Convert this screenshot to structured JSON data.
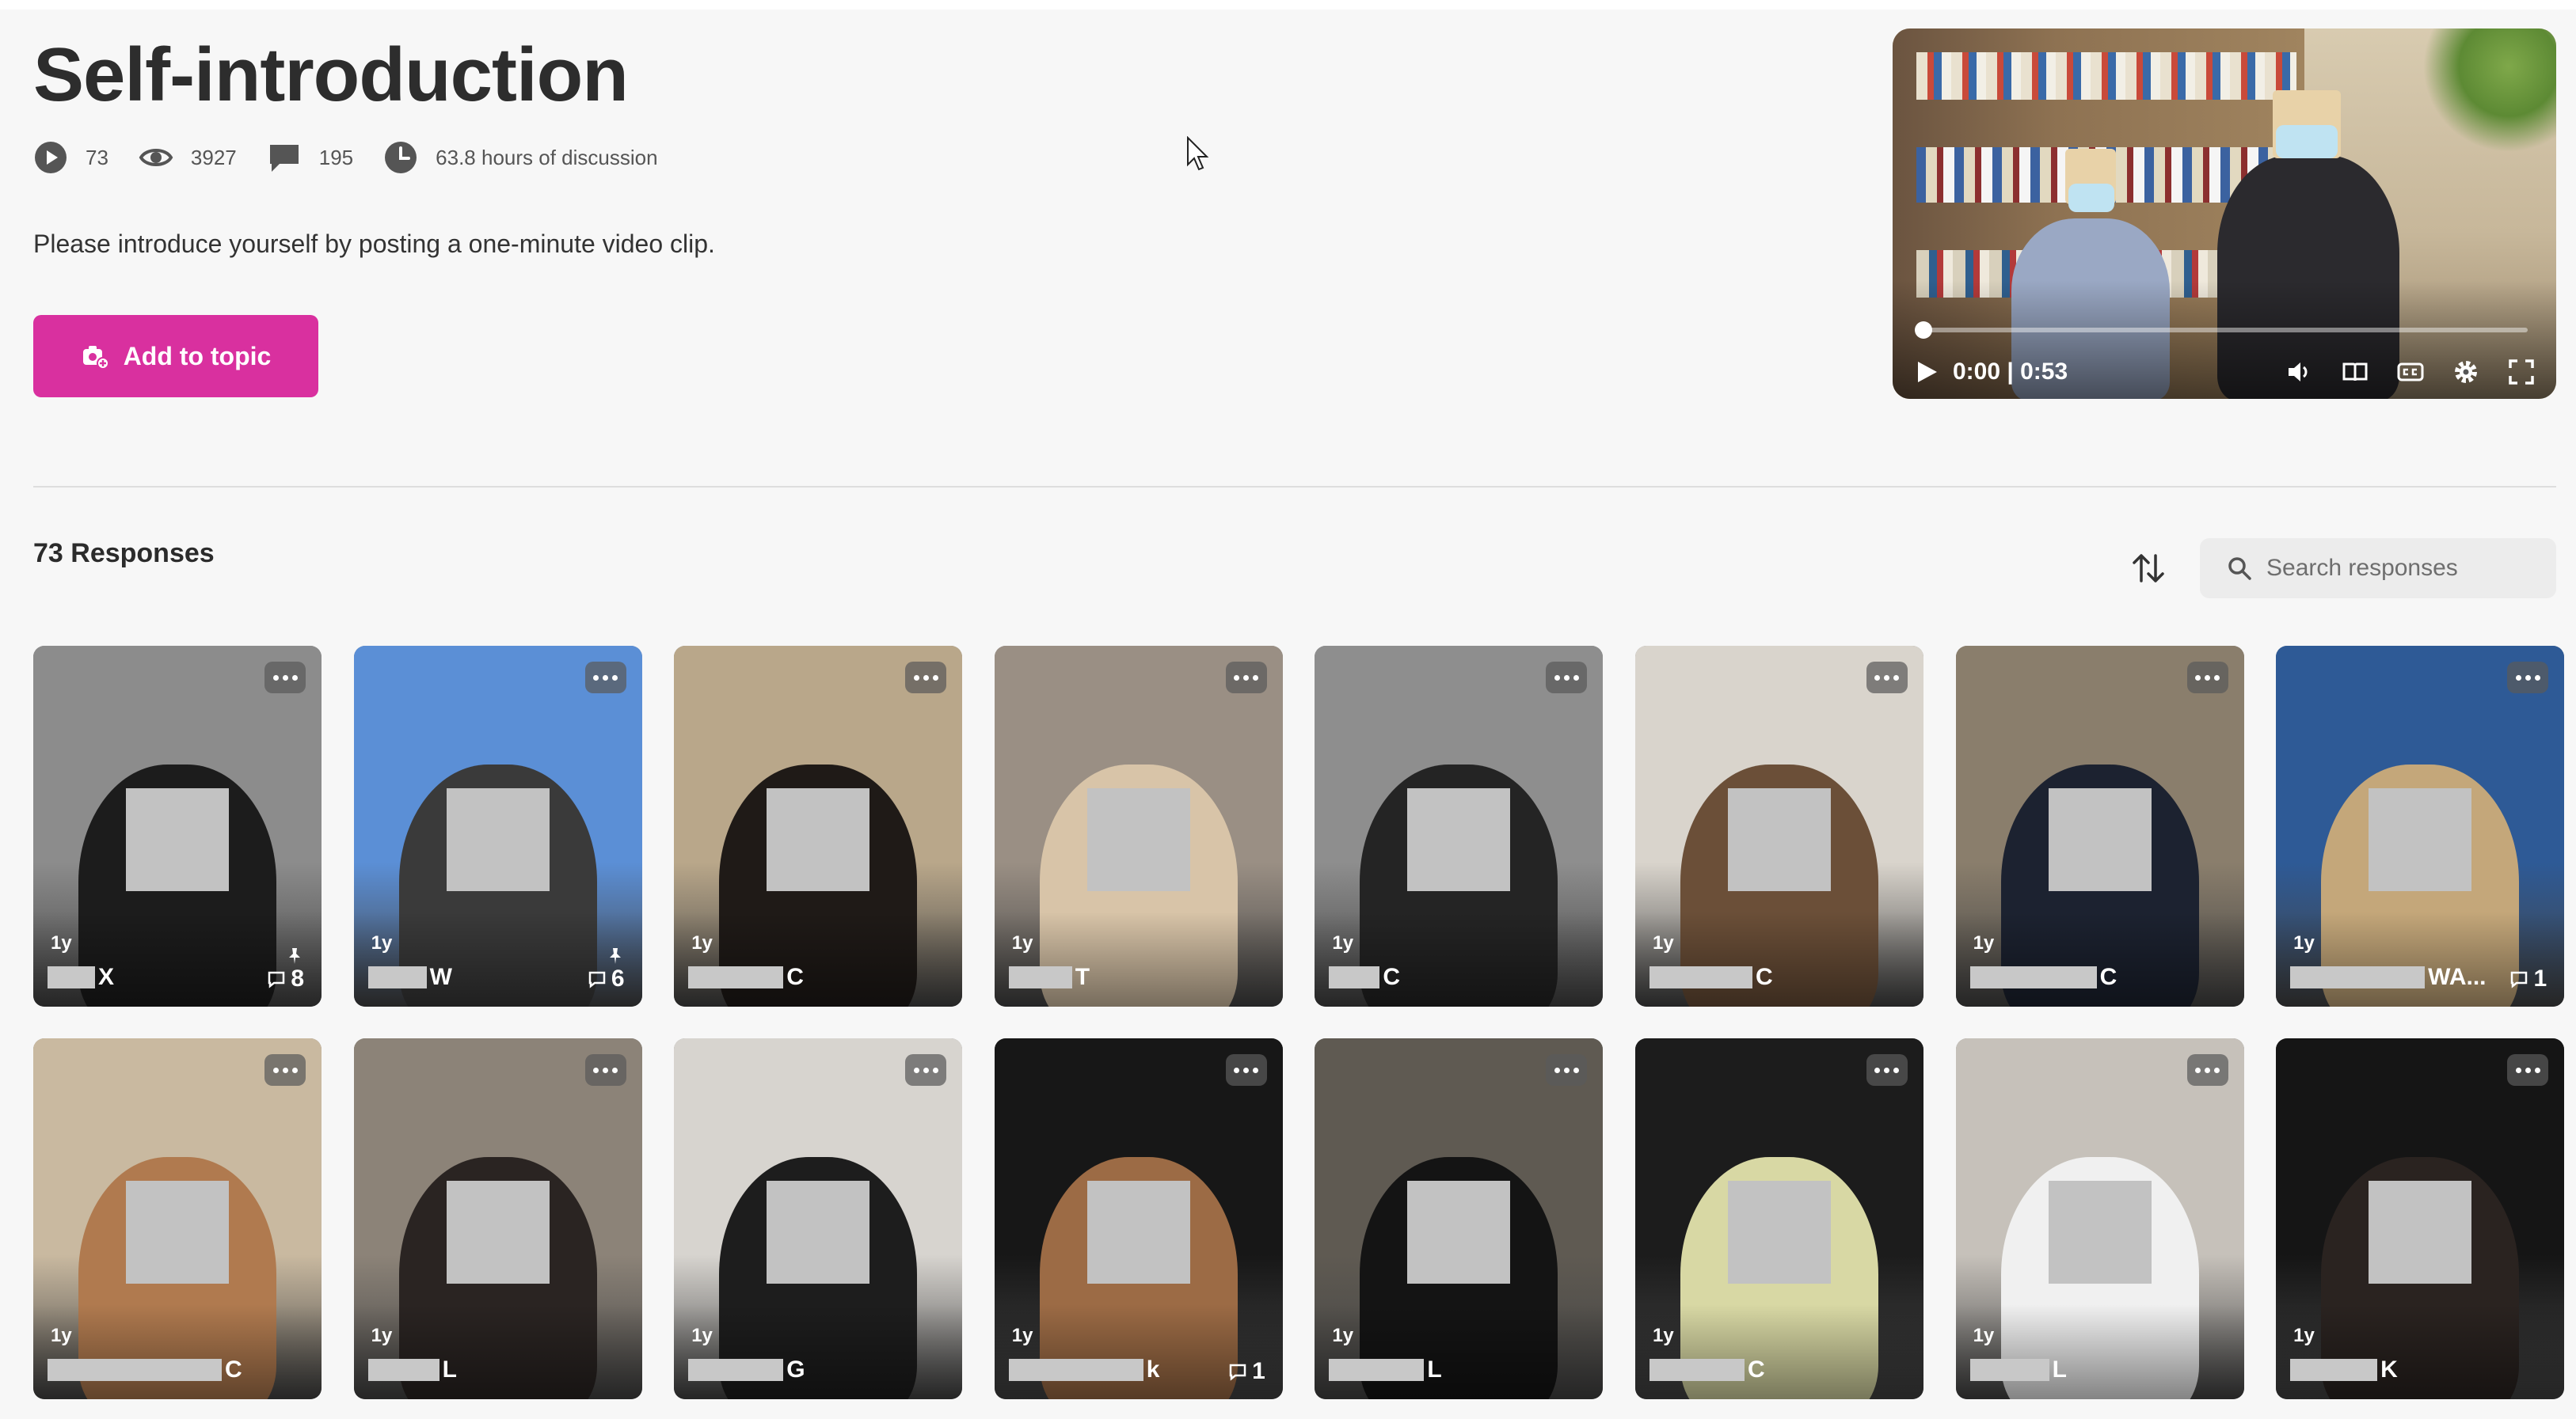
{
  "topic": {
    "title": "Self-introduction",
    "description": "Please introduce yourself by posting a one-minute video clip.",
    "stats": {
      "videos": "73",
      "views": "3927",
      "comments": "195",
      "discussion": "63.8 hours of discussion"
    },
    "add_button_label": "Add to topic"
  },
  "video_player": {
    "time": "0:00 | 0:53",
    "progress": 0
  },
  "responses": {
    "heading": "73 Responses",
    "search_placeholder": "Search responses",
    "cards": [
      {
        "age": "1y",
        "name": "X",
        "redact_width": 60,
        "pinned": true,
        "comments": "8",
        "bg": "#8c8c8c",
        "figure": "#1c1c1c"
      },
      {
        "age": "1y",
        "name": "W",
        "redact_width": 74,
        "pinned": true,
        "comments": "6",
        "bg": "#5b8fd6",
        "figure": "#3a3a3a"
      },
      {
        "age": "1y",
        "name": "C",
        "redact_width": 120,
        "pinned": false,
        "comments": "",
        "bg": "#b9a78a",
        "figure": "#1f1a17"
      },
      {
        "age": "1y",
        "name": "T",
        "redact_width": 80,
        "pinned": false,
        "comments": "",
        "bg": "#9a8f84",
        "figure": "#d8c4a8"
      },
      {
        "age": "1y",
        "name": "C",
        "redact_width": 64,
        "pinned": false,
        "comments": "",
        "bg": "#8e8e8e",
        "figure": "#242424"
      },
      {
        "age": "1y",
        "name": "C",
        "redact_width": 130,
        "pinned": false,
        "comments": "",
        "bg": "#d9d4cc",
        "figure": "#6b4f38"
      },
      {
        "age": "1y",
        "name": "C",
        "redact_width": 160,
        "pinned": false,
        "comments": "",
        "bg": "#8a7e6c",
        "figure": "#1c2230"
      },
      {
        "age": "1y",
        "name": "WA...",
        "redact_width": 170,
        "pinned": false,
        "comments": "1",
        "bg": "#2e5a96",
        "figure": "#c4a77a"
      },
      {
        "age": "1y",
        "name": "C",
        "redact_width": 220,
        "pinned": false,
        "comments": "",
        "bg": "#c9b9a0",
        "figure": "#b07a4f"
      },
      {
        "age": "1y",
        "name": "L",
        "redact_width": 90,
        "pinned": false,
        "comments": "",
        "bg": "#8c8378",
        "figure": "#2a2422"
      },
      {
        "age": "1y",
        "name": "G",
        "redact_width": 120,
        "pinned": false,
        "comments": "",
        "bg": "#d7d4cf",
        "figure": "#1d1d1d"
      },
      {
        "age": "1y",
        "name": "k",
        "redact_width": 170,
        "pinned": false,
        "comments": "1",
        "bg": "#171717",
        "figure": "#9c6b45"
      },
      {
        "age": "1y",
        "name": "L",
        "redact_width": 120,
        "pinned": false,
        "comments": "",
        "bg": "#5f5a52",
        "figure": "#141414"
      },
      {
        "age": "1y",
        "name": "C",
        "redact_width": 120,
        "pinned": false,
        "comments": "",
        "bg": "#1c1c1c",
        "figure": "#d8d8a4"
      },
      {
        "age": "1y",
        "name": "L",
        "redact_width": 100,
        "pinned": false,
        "comments": "",
        "bg": "#c6c1ba",
        "figure": "#f0f0f0"
      },
      {
        "age": "1y",
        "name": "K",
        "redact_width": 110,
        "pinned": false,
        "comments": "",
        "bg": "#151515",
        "figure": "#2a2320"
      }
    ]
  },
  "colors": {
    "accent": "#d9309f",
    "page_bg": "#f7f7f7"
  }
}
